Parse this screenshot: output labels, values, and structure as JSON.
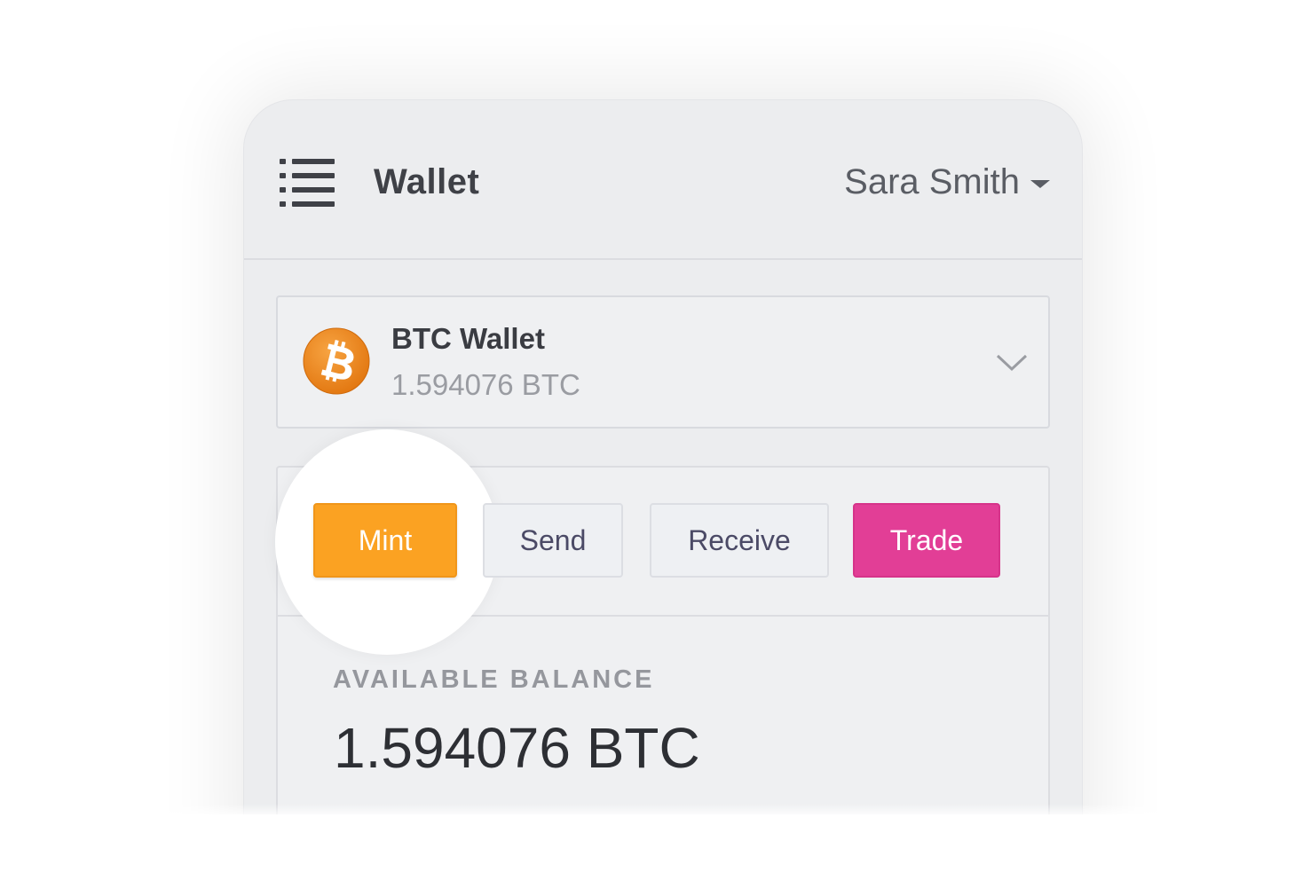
{
  "header": {
    "title": "Wallet",
    "user_name": "Sara Smith"
  },
  "wallet_selector": {
    "name": "BTC Wallet",
    "amount": "1.594076 BTC",
    "coin_icon": "bitcoin-icon",
    "coin_color": "#f08a1c"
  },
  "actions": {
    "mint_label": "Mint",
    "send_label": "Send",
    "receive_label": "Receive",
    "trade_label": "Trade",
    "mint_color": "#fba222",
    "trade_color": "#e23e96"
  },
  "balance": {
    "label": "AVAILABLE BALANCE",
    "value": "1.594076 BTC"
  }
}
